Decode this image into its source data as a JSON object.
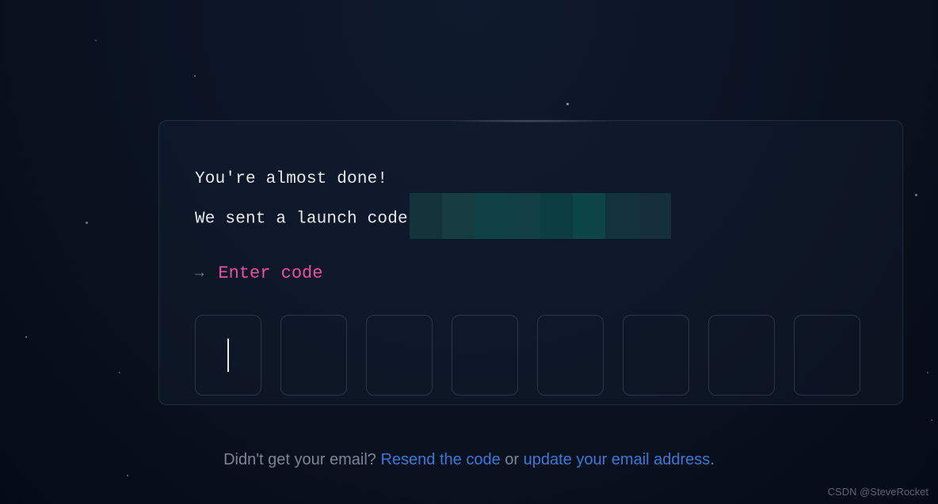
{
  "heading": {
    "line1": "You're almost done!",
    "line2_prefix": "We sent a launch code"
  },
  "prompt": {
    "arrow": "→",
    "label": "Enter code"
  },
  "code_input": {
    "length": 8,
    "values": [
      "",
      "",
      "",
      "",
      "",
      "",
      "",
      ""
    ]
  },
  "footer": {
    "prefix": "Didn't get your email? ",
    "resend_link": "Resend the code",
    "middle": " or ",
    "update_link": "update your email address",
    "suffix": "."
  },
  "watermark": "CSDN @SteveRocket"
}
